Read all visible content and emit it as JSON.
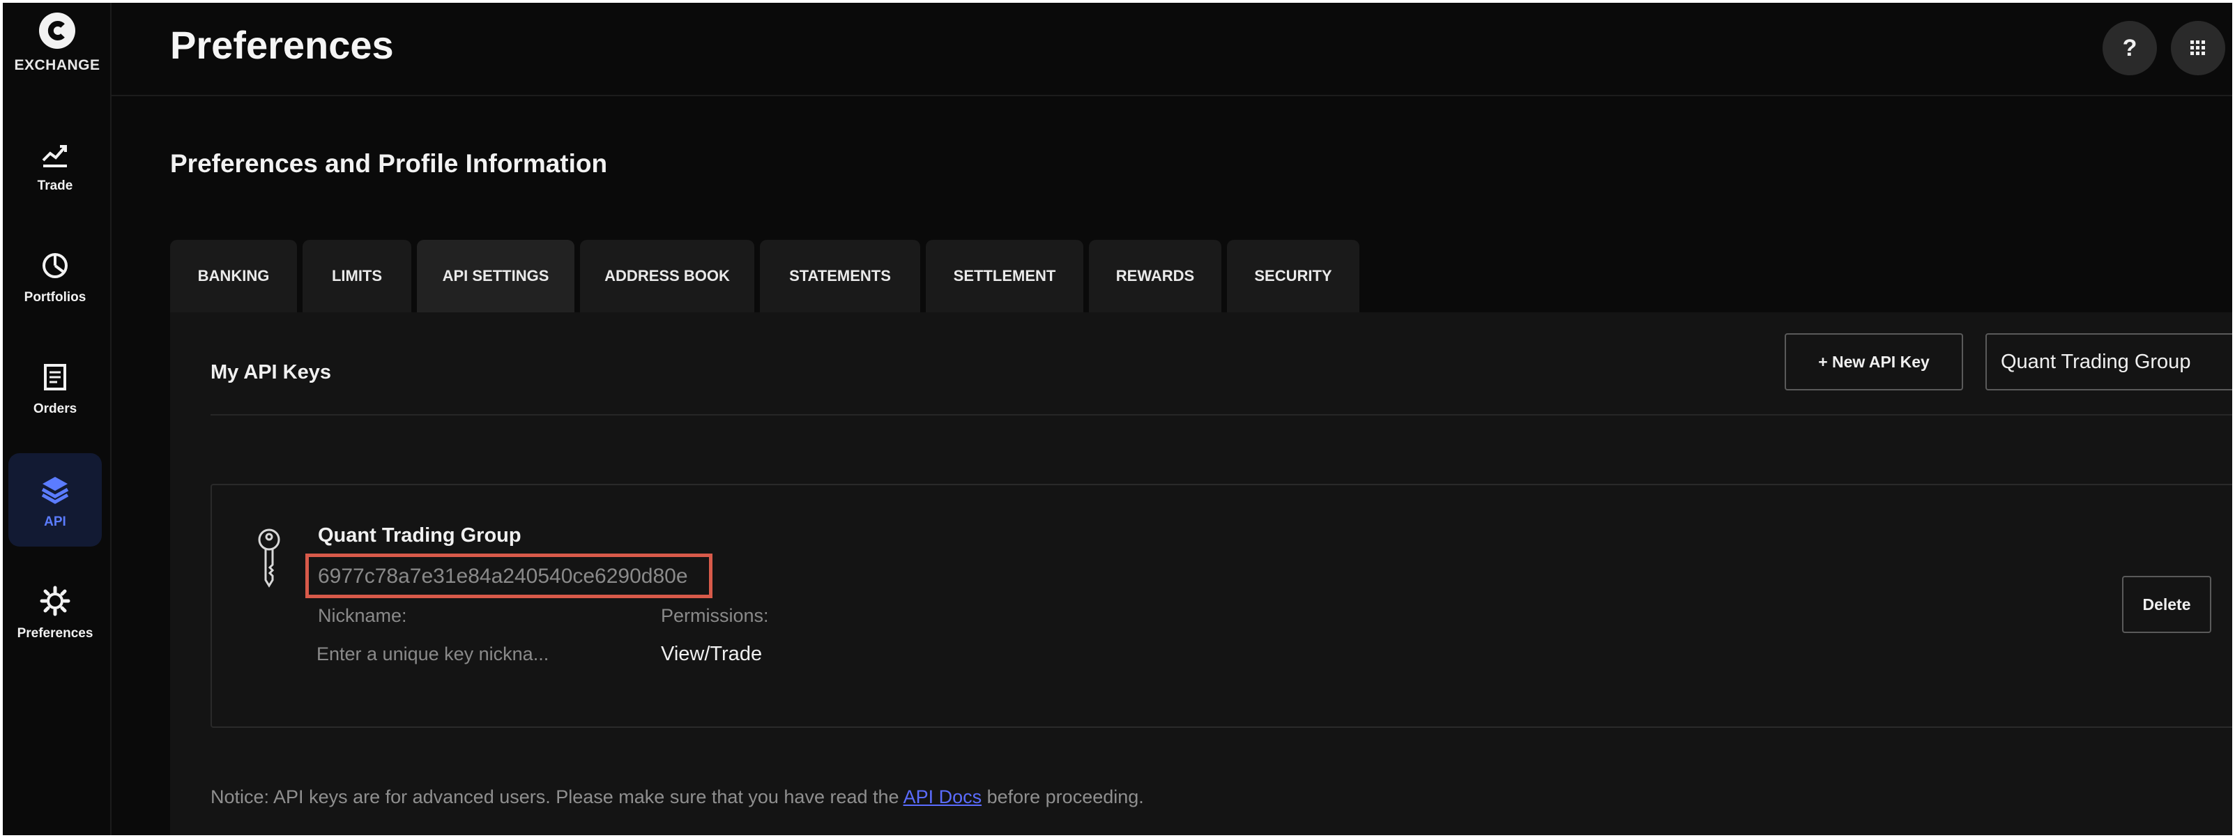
{
  "brand": {
    "logo_text": "EXCHANGE"
  },
  "sidebar": {
    "items": [
      {
        "label": "Trade",
        "icon": "trend-chart-icon",
        "active": false
      },
      {
        "label": "Portfolios",
        "icon": "pie-chart-icon",
        "active": false
      },
      {
        "label": "Orders",
        "icon": "document-icon",
        "active": false
      },
      {
        "label": "API",
        "icon": "layers-icon",
        "active": true
      },
      {
        "label": "Preferences",
        "icon": "gear-icon",
        "active": false
      }
    ]
  },
  "header": {
    "title": "Preferences",
    "help_label": "?",
    "apps_icon": "grid-icon"
  },
  "main": {
    "section_title": "Preferences and Profile Information",
    "tabs": [
      {
        "label": "BANKING",
        "active": false
      },
      {
        "label": "LIMITS",
        "active": false
      },
      {
        "label": "API SETTINGS",
        "active": true
      },
      {
        "label": "ADDRESS BOOK",
        "active": false
      },
      {
        "label": "STATEMENTS",
        "active": false
      },
      {
        "label": "SETTLEMENT",
        "active": false
      },
      {
        "label": "REWARDS",
        "active": false
      },
      {
        "label": "SECURITY",
        "active": false
      }
    ],
    "panel": {
      "title": "My API Keys",
      "new_key_label": "+ New API Key",
      "group_select_value": "Quant Trading Group",
      "key": {
        "name": "Quant Trading Group",
        "id": "6977c78a7e31e84a240540ce6290d80e",
        "nickname_label": "Nickname:",
        "nickname_placeholder": "Enter a unique key nickna...",
        "permissions_label": "Permissions:",
        "permissions_value": "View/Trade",
        "delete_label": "Delete"
      },
      "notice": {
        "before": "Notice: API keys are for advanced users. Please make sure that you have read the ",
        "link": "API Docs",
        "after": " before proceeding."
      }
    }
  },
  "colors": {
    "background": "#0a0a0a",
    "panel": "#141414",
    "accent": "#5b7cff",
    "highlight_box": "#d85a4a"
  }
}
